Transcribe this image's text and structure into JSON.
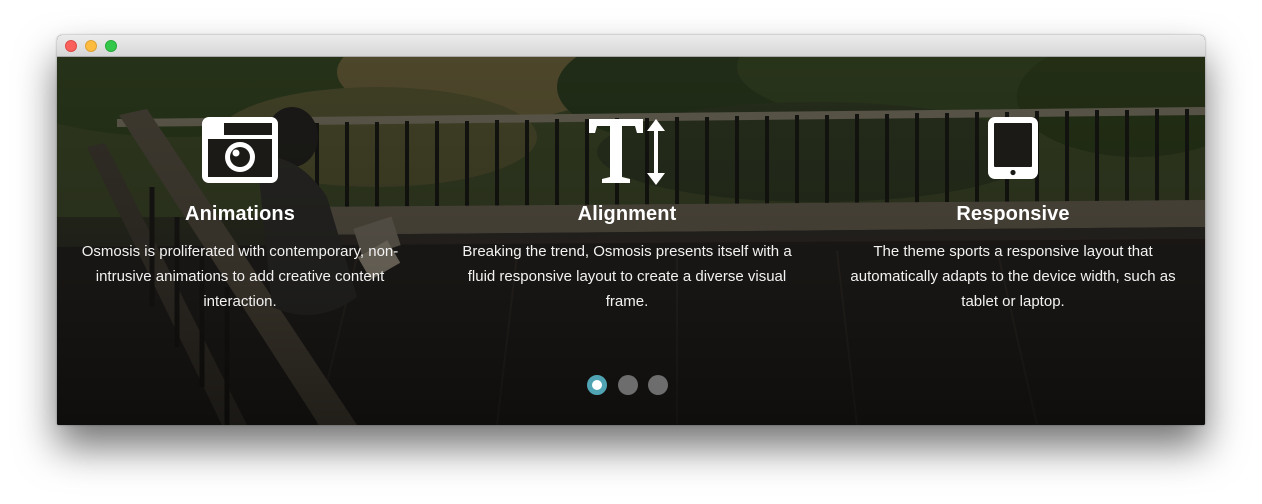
{
  "window": {
    "controls": [
      "close-button",
      "minimize-button",
      "zoom-button"
    ]
  },
  "features": [
    {
      "icon": "camera-icon",
      "title": "Animations",
      "text": "Osmosis is proliferated with contemporary, non-intrusive animations to add creative content interaction."
    },
    {
      "icon": "text-height-icon",
      "title": "Alignment",
      "text": "Breaking the trend, Osmosis presents itself with a fluid responsive layout to create a diverse visual frame."
    },
    {
      "icon": "tablet-icon",
      "title": "Responsive",
      "text": "The theme sports a responsive layout that automatically adapts to the device width, such as tablet or laptop."
    }
  ],
  "carousel": {
    "pages": 3,
    "active_page": 1,
    "active_color": "#4fa3b3",
    "inactive_color": "#6d6d6d"
  }
}
